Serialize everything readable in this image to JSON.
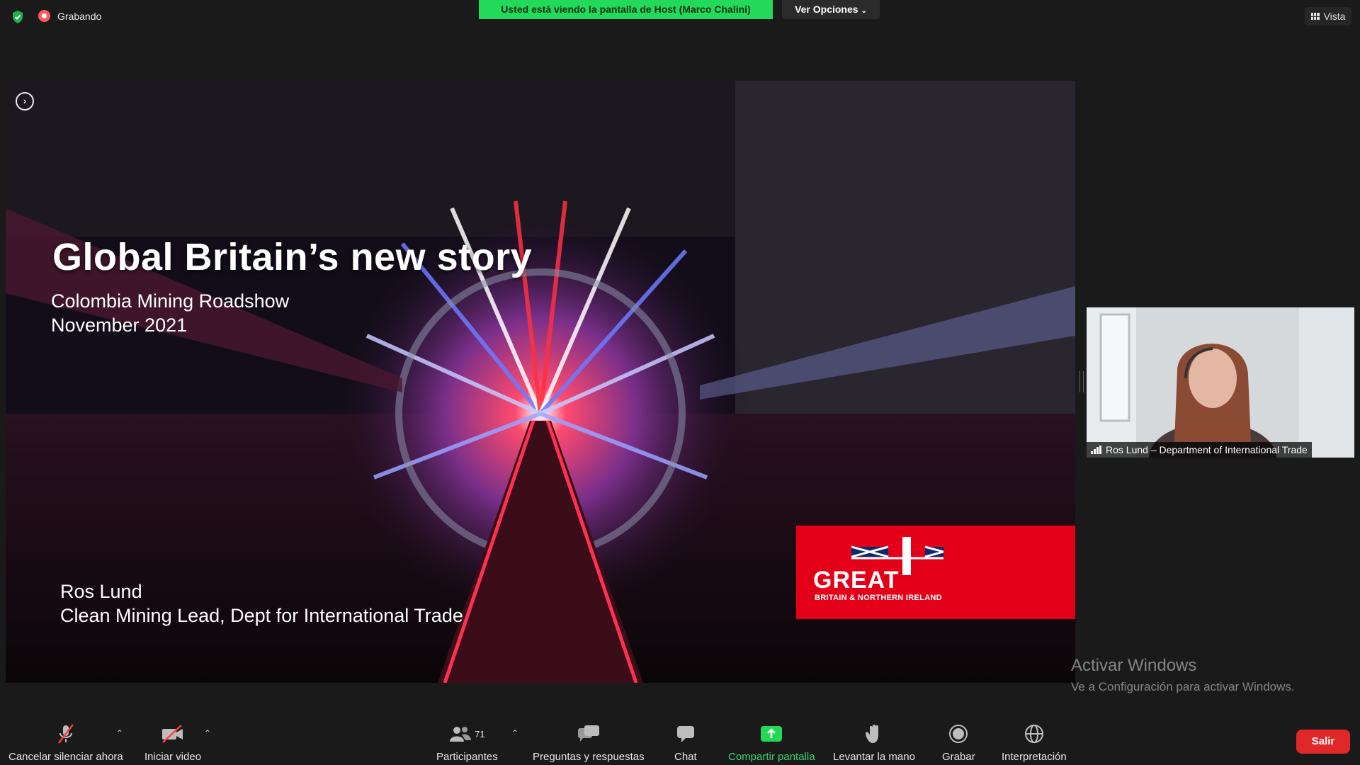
{
  "topbar": {
    "recording_label": "Grabando",
    "viewing_banner": "Usted está viendo la pantalla de Host (Marco Chalini)",
    "view_options_label": "Ver Opciones",
    "view_label": "Vista"
  },
  "slide": {
    "title": "Global Britain’s new story",
    "subtitle_line1": "Colombia Mining Roadshow",
    "subtitle_line2": "November 2021",
    "presenter_name": "Ros Lund",
    "presenter_role": "Clean Mining Lead, Dept for International Trade",
    "logo_word": "GREAT",
    "logo_subtitle": "BRITAIN & NORTHERN IRELAND",
    "logo_color": "#e50019"
  },
  "participant_video": {
    "name": "Ros Lund – Department of International Trade"
  },
  "watermark": {
    "line1": "Activar Windows",
    "line2": "Ve a Configuración para activar Windows."
  },
  "toolbar": {
    "mute": "Cancelar silenciar ahora",
    "video": "Iniciar video",
    "participants": "Participantes",
    "participants_count": "71",
    "qa": "Preguntas y respuestas",
    "chat": "Chat",
    "share": "Compartir pantalla",
    "raise_hand": "Levantar la mano",
    "record": "Grabar",
    "interpretation": "Interpretación",
    "exit": "Salir"
  },
  "colors": {
    "banner_green": "#23d959",
    "share_green": "#23d959",
    "exit_red": "#e02828",
    "background": "#1a1a1a"
  }
}
